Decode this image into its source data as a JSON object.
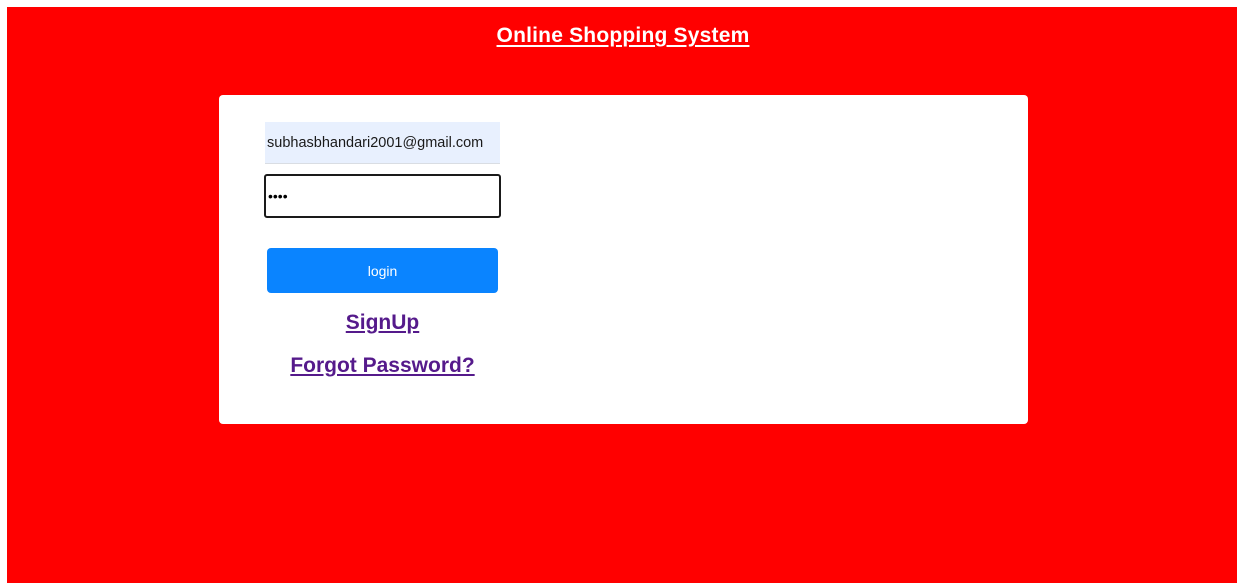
{
  "header": {
    "title": "Online Shopping System"
  },
  "login_form": {
    "email_value": "subhasbhandari2001@gmail.com",
    "password_value": "1234",
    "login_label": "login",
    "signup_label": "SignUp",
    "forgot_label": "Forgot Password?"
  },
  "colors": {
    "background": "#ff0000",
    "card": "#ffffff",
    "button": "#0a84ff",
    "link": "#551a8b",
    "autofill": "#e8f0fe"
  }
}
